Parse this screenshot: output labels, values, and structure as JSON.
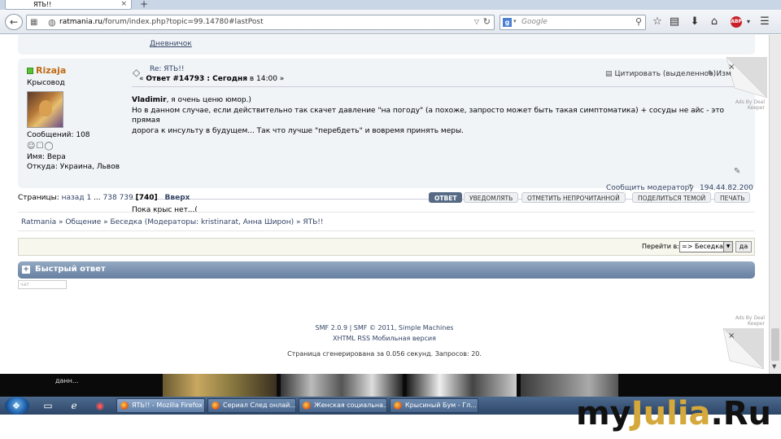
{
  "browser": {
    "tab_title": "ЯТЬ!!",
    "tab_close": "×",
    "new_tab": "+",
    "url_domain": "ratmania.ru",
    "url_path": "/forum/index.php?topic=99.14780#lastPost",
    "search_engine": "g",
    "search_placeholder": "Google"
  },
  "signature_bar": {
    "diary_link": "Дневничок"
  },
  "post": {
    "poster_name": "Rizaja",
    "poster_title": "Крысовод",
    "post_count": "Сообщений: 108",
    "poster_real_name": "Имя: Вера",
    "poster_from": "Откуда: Украина, Львов",
    "subject": "Re: ЯТЬ!!",
    "reply_prefix": "« ",
    "reply_number": "Ответ #14793 : Сегодня",
    "reply_in": " в 14:00 »",
    "quote_button": "Цитировать (выделенное)",
    "edit_button": "Изменить",
    "body_user": "Vladimir",
    "body_line1_rest": ", я очень ценю юмор.)",
    "body_line2": "Но в данном случае, если действительно так скачет давление \"на погоду\" (а похоже, запросто может быть такая симптоматика) + сосуды не айс - это прямая",
    "body_line3": "дорога к инсульту в будущем... Так что лучше \"перебдеть\" и вовремя принять меры.",
    "report_link": "Сообщить модератору",
    "ip_address": "194.44.82.200",
    "signature": "Пока крыс нет...("
  },
  "pagination": {
    "label": "Страницы: ",
    "back": "назад",
    "page1": "1",
    "ellipsis": "...",
    "page738": "738",
    "page739": "739",
    "current": "[740]",
    "top_link": "Вверх"
  },
  "buttons": {
    "reply": "ОТВЕТ",
    "notify": "УВЕДОМЛЯТЬ",
    "mark_unread": "ОТМЕТИТЬ НЕПРОЧИТАННОЙ",
    "share": "ПОДЕЛИТЬСЯ ТЕМОЙ",
    "print": "ПЕЧАТЬ"
  },
  "breadcrumb": {
    "text": "Ratmania » Общение » Беседка (Модераторы: kristinarat, Анна Широн) » ЯТЬ!!"
  },
  "jump": {
    "label": "Перейти в:",
    "selected": "=> Беседка",
    "go": "да"
  },
  "quick_reply": {
    "title": "Быстрый ответ",
    "input_hint": "чат"
  },
  "footer": {
    "credits": "SMF 2.0.9 | SMF © 2011, Simple Machines",
    "links": "XHTML   RSS   Мобильная версия",
    "stats": "Страница сгенерирована за 0.056 секунд. Запросов: 20."
  },
  "ads": {
    "label1": "Ads By Deal",
    "label2": "Keeper",
    "close": "×"
  },
  "desktop": {
    "strip_text": "данн..."
  },
  "taskbar": {
    "items": [
      "ЯТЬ!! - Mozilla Firefox",
      "Сериал След онлай...",
      "Женская социальна...",
      "Крысиный Бум - Гл..."
    ]
  },
  "watermark": {
    "part1": "my",
    "part2": "Julia",
    "part3": ".Ru"
  }
}
